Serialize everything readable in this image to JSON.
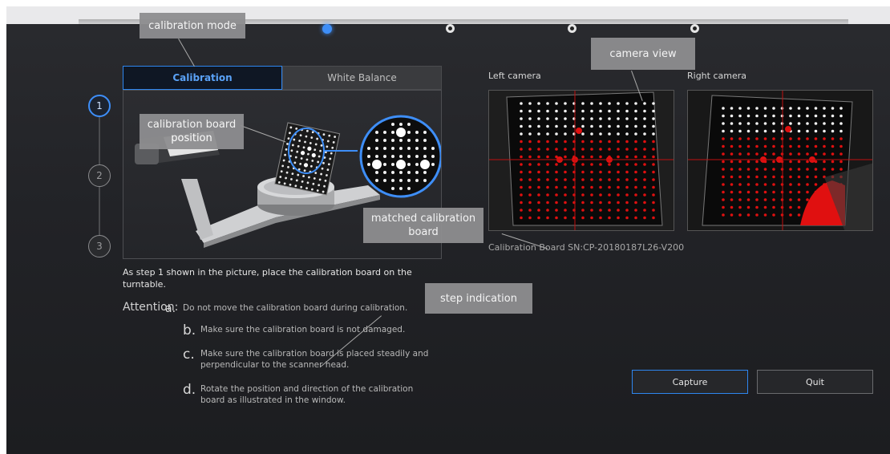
{
  "mode_tabs": {
    "calibration": "Calibration",
    "white_balance": "White Balance"
  },
  "steps": [
    "1",
    "2",
    "3"
  ],
  "active_step": "1",
  "cameras": {
    "left_label": "Left camera",
    "right_label": "Right camera",
    "board_sn": "Calibration Board SN:CP-20180187L26-V200"
  },
  "instruction": "As step 1 shown in the picture, place the calibration board on the turntable.",
  "attention": {
    "title": "Attention:",
    "items": [
      {
        "letter": "a.",
        "text": "Do not move the calibration board during calibration."
      },
      {
        "letter": "b.",
        "text": "Make sure the calibration board is not damaged."
      },
      {
        "letter": "c.",
        "text": "Make sure the calibration board is placed steadily and perpendicular to the scanner head."
      },
      {
        "letter": "d.",
        "text": "Rotate the position and direction of the calibration board as illustrated in the window."
      }
    ]
  },
  "buttons": {
    "capture": "Capture",
    "quit": "Quit"
  },
  "annotations": {
    "calibration_mode": "calibration mode",
    "board_position": "calibration board position",
    "camera_view": "camera view",
    "matched_board": "matched calibration board",
    "step_indication": "step indication"
  },
  "colors": {
    "accent": "#2e86ef",
    "matched_dot": "#e01010",
    "callout_bg": "#8e8e90"
  }
}
